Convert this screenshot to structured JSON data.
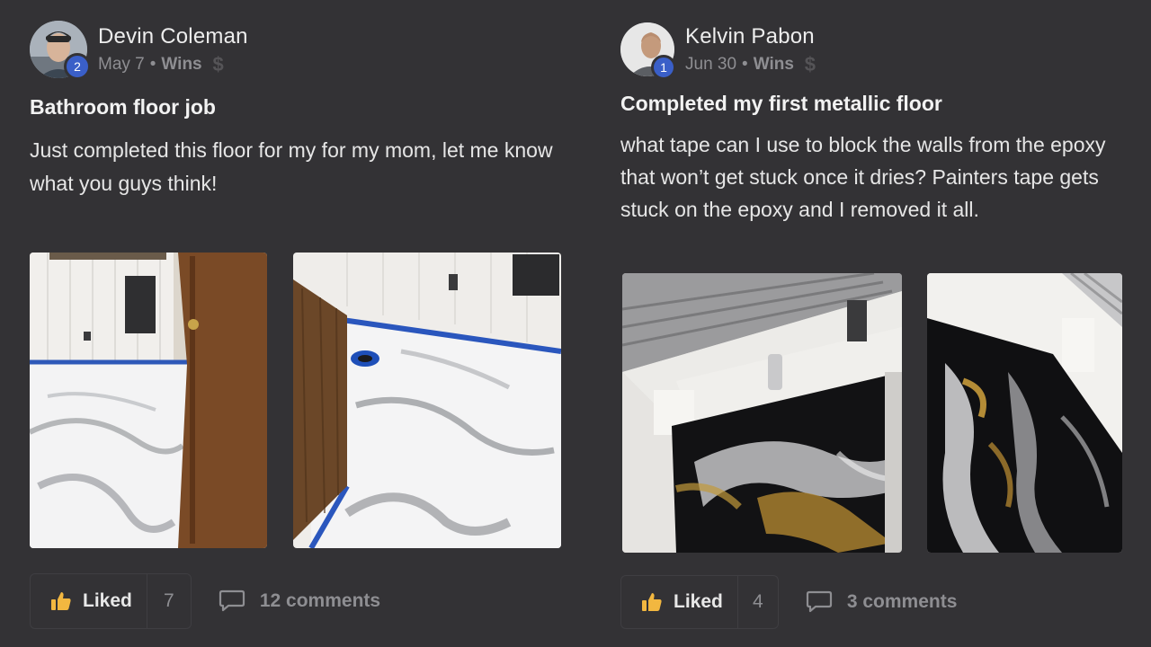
{
  "posts": [
    {
      "author": "Devin Coleman",
      "level": "2",
      "date": "May 7",
      "separator": "•",
      "category": "Wins",
      "title": "Bathroom floor job",
      "body": "Just completed this floor for my for my mom, let me know what you guys think!",
      "like_label": "Liked",
      "like_count": "7",
      "comments_label": "12 comments"
    },
    {
      "author": "Kelvin Pabon",
      "level": "1",
      "date": "Jun 30",
      "separator": "•",
      "category": "Wins",
      "title": "Completed my first metallic floor",
      "body": "what tape can I use to block the walls from the epoxy that won’t get stuck once it dries? Painters tape gets stuck on the epoxy and I removed it all.",
      "like_label": "Liked",
      "like_count": "4",
      "comments_label": "3 comments"
    }
  ],
  "icons": {
    "dollar": "$",
    "thumb": "thumbs-up-icon",
    "comment": "comment-icon"
  },
  "colors": {
    "background": "#333235",
    "badge": "#3a5fc8",
    "like_thumb": "#f2b740",
    "muted_text": "#8e8e92"
  }
}
